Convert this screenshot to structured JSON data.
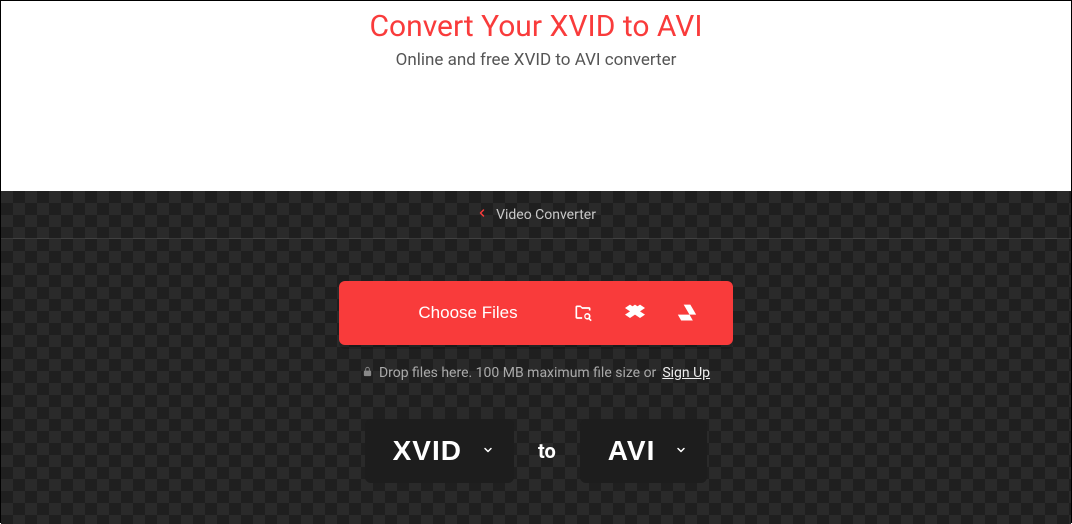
{
  "header": {
    "title": "Convert Your XVID to AVI",
    "subtitle": "Online and free XVID to AVI converter"
  },
  "breadcrumb": {
    "label": "Video Converter"
  },
  "upload": {
    "choose_label": "Choose Files",
    "hint_prefix": "Drop files here. 100 MB maximum file size or",
    "signup_label": "Sign Up"
  },
  "formats": {
    "from": "XVID",
    "to_word": "to",
    "to": "AVI"
  }
}
